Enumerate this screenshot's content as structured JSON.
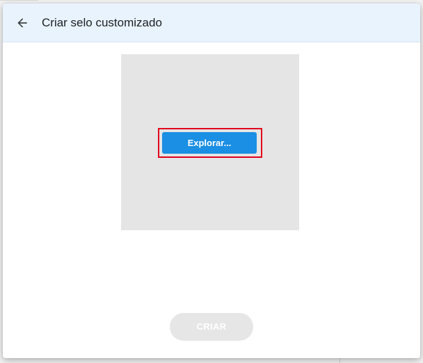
{
  "dialog": {
    "title": "Criar selo customizado",
    "back_icon": "arrow-left-icon",
    "browse_label": "Explorar...",
    "create_label": "CRIAR",
    "create_disabled": true
  },
  "colors": {
    "header_background": "#e8f3fd",
    "drop_area_background": "#e5e5e5",
    "browse_button": "#1a8fe3",
    "highlight_border": "#e0001b",
    "create_button_disabled": "#e6e6e6"
  }
}
